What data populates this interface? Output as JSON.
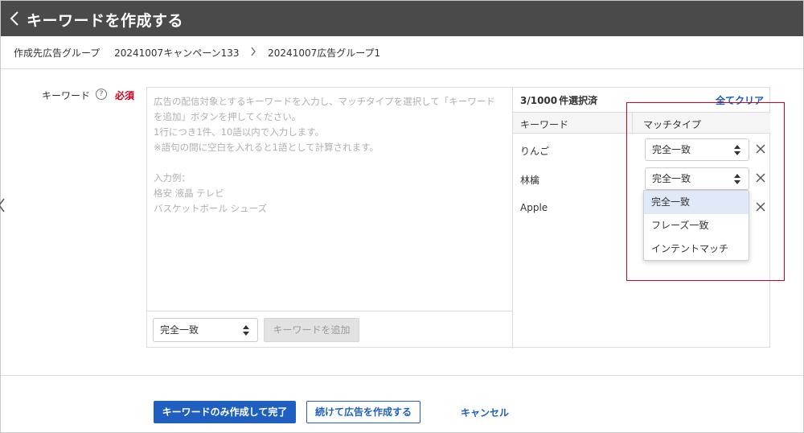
{
  "header": {
    "title": "キーワードを作成する",
    "back_icon": "chevron-left-icon"
  },
  "breadcrumb": {
    "label": "作成先広告グループ",
    "campaign": "20241007キャンペーン133",
    "separator_icon": "chevron-right-icon",
    "ad_group": "20241007広告グループ1"
  },
  "form": {
    "keyword_label": "キーワード",
    "help_icon": "question-circle-icon",
    "required_label": "必須",
    "input_placeholder": "広告の配信対象とするキーワードを入力し、マッチタイプを選択して「キーワード\nを追加」ボタンを押してください。\n1行につき1件、10語以内で入力します。\n※語句の間に空白を入れると1語として計算されます。\n\n入力例：\n格安 液晶 テレビ\nバスケットボール シューズ",
    "match_type_select": "完全一致",
    "add_button": "キーワードを追加"
  },
  "selected_list": {
    "count": "3/1000",
    "count_suffix": "件選択済",
    "clear_all": "全てクリア",
    "col_keyword": "キーワード",
    "col_match": "マッチタイプ",
    "rows": [
      {
        "keyword": "りんご",
        "match": "完全一致"
      },
      {
        "keyword": "林檎",
        "match": "完全一致"
      },
      {
        "keyword": "Apple",
        "match": ""
      }
    ],
    "remove_icon": "close-icon"
  },
  "dropdown": {
    "options": [
      "完全一致",
      "フレーズ一致",
      "インテントマッチ"
    ],
    "selected_index": 0
  },
  "footer": {
    "primary_button": "キーワードのみ作成して完了",
    "secondary_button": "続けて広告を作成する",
    "cancel_link": "キャンセル"
  },
  "colors": {
    "header_bg": "#4a4a4a",
    "primary": "#1f5fbf",
    "required": "#d0021b",
    "highlight": "#d0021b",
    "dropdown_selected": "#dfe9f7"
  }
}
